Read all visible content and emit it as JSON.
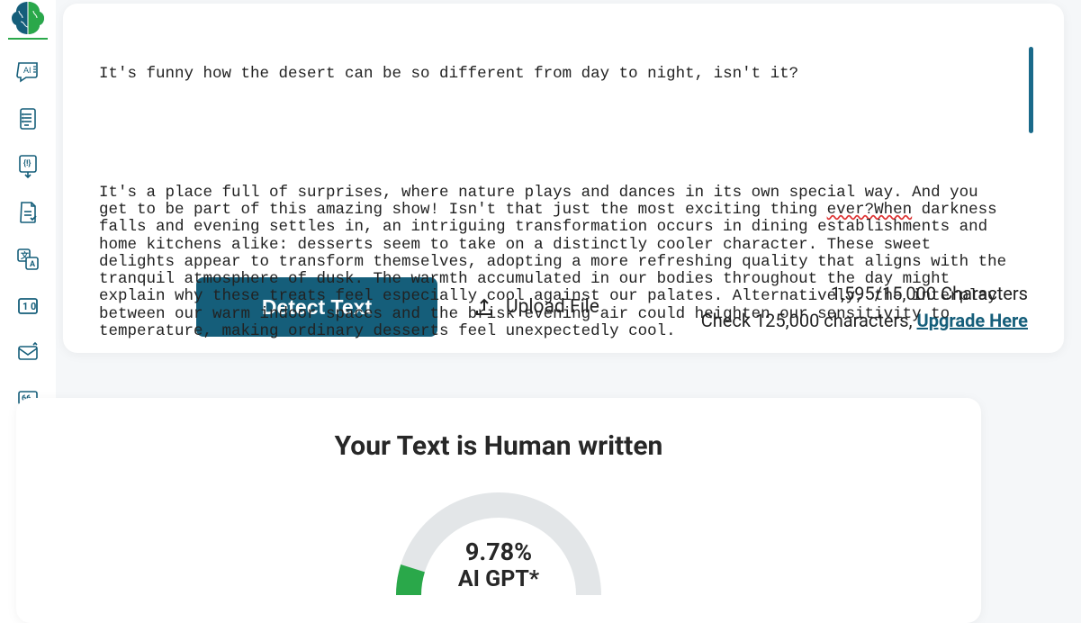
{
  "sidebar": {
    "items": [
      {
        "name": "brain-logo"
      },
      {
        "name": "ai-chat"
      },
      {
        "name": "document-list"
      },
      {
        "name": "download-analysis"
      },
      {
        "name": "doc-check"
      },
      {
        "name": "translate"
      },
      {
        "name": "code-view"
      },
      {
        "name": "mail"
      },
      {
        "name": "quote"
      }
    ]
  },
  "editor": {
    "line1": "It's funny how the desert can be so different from day to night, isn't it?",
    "para2_a": "It's a place full of surprises, where nature plays and dances in its own special way. And you get to be part of this amazing show! Isn't that just the most exciting thing ",
    "squiggle": "ever?When",
    "para2_b": " darkness falls and evening settles in, an intriguing transformation occurs in dining establishments and home kitchens alike: desserts seem to take on a distinctly cooler character. These sweet delights appear to transform themselves, adopting a more refreshing quality that aligns with the tranquil atmosphere of dusk. The warmth accumulated in our bodies throughout the day might explain why these treats feel especially cool against our palates. Alternatively, the interplay between our warm indoor spaces and the brisk evening air could heighten our sensitivity to temperature, making ordinary desserts feel unexpectedly cool."
  },
  "actions": {
    "detect_label": "Detect Text",
    "upload_label": "Upload File"
  },
  "char_info": {
    "count_display": "1,595/15,000 Characters",
    "check_prefix": "Check 125,000 characters, ",
    "upgrade_label": "Upgrade Here"
  },
  "result": {
    "title": "Your Text is Human written",
    "percent": "9.78%",
    "label": "AI GPT*"
  },
  "chart_data": {
    "type": "gauge",
    "value": 9.78,
    "min": 0,
    "max": 100,
    "unit": "%",
    "title": "AI GPT*",
    "colors": {
      "fill": "#2aa84a",
      "track": "#e3e6e8"
    }
  }
}
